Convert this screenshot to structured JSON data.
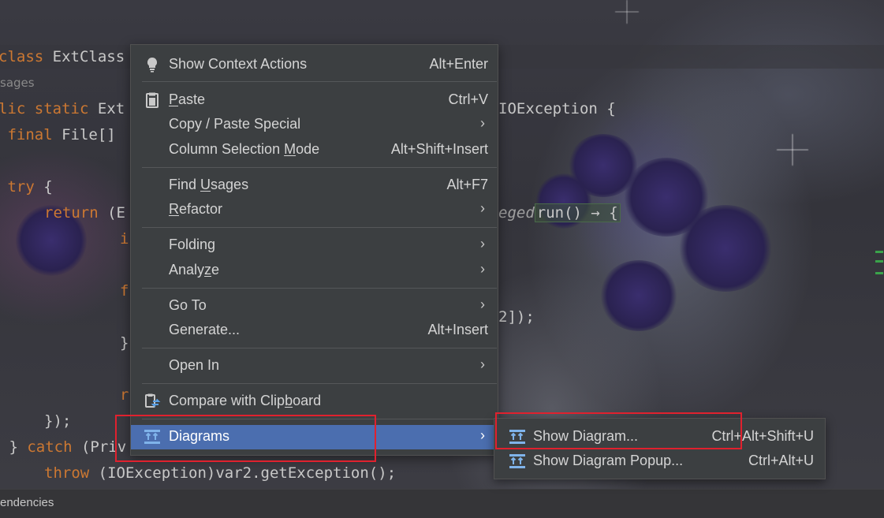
{
  "editor": {
    "lines": [
      {
        "kw": "",
        "text": "class ExtClass"
      },
      {
        "usages": "sages"
      },
      {
        "kw": "lic static ",
        "text": "Ext"
      },
      {
        "kw": " final ",
        "text": "File[]"
      },
      {
        "kw": " try",
        "text": " {"
      },
      {
        "kw": "return",
        "text": " (E"
      },
      {
        "text": "i"
      },
      {
        "text": "f"
      },
      {
        "text": "}"
      },
      {
        "text": "r"
      },
      {
        "text": "});"
      },
      {
        "kw": "catch",
        "pre": " } ",
        "text": " (Priv"
      },
      {
        "kw": "throw",
        "text": " (IOException)var2.getException();"
      }
    ],
    "right_fragments": {
      "ioexception": "IOException {",
      "privileged_fn": "eged",
      "lambda": "run() → {",
      "array_end": "2]);"
    }
  },
  "bottom_panel": {
    "label": "endencies"
  },
  "context_menu": {
    "items": [
      {
        "label": "Show Context Actions",
        "shortcut": "Alt+Enter",
        "icon": "bulb-icon"
      },
      {
        "label_pre": "",
        "label_u": "P",
        "label_post": "aste",
        "shortcut": "Ctrl+V",
        "icon": "clipboard-icon"
      },
      {
        "label": "Copy / Paste Special",
        "submenu": true
      },
      {
        "label_pre": "Column Selection ",
        "label_u": "M",
        "label_post": "ode",
        "shortcut": "Alt+Shift+Insert"
      },
      {
        "label_pre": "Find ",
        "label_u": "U",
        "label_post": "sages",
        "shortcut": "Alt+F7"
      },
      {
        "label_pre": "",
        "label_u": "R",
        "label_post": "efactor",
        "submenu": true
      },
      {
        "label": "Folding",
        "submenu": true
      },
      {
        "label_pre": "Analy",
        "label_u": "z",
        "label_post": "e",
        "submenu": true
      },
      {
        "label": "Go To",
        "submenu": true
      },
      {
        "label": "Generate...",
        "shortcut": "Alt+Insert"
      },
      {
        "label": "Open In",
        "submenu": true
      },
      {
        "label_pre": "Compare with Clip",
        "label_u": "b",
        "label_post": "oard",
        "icon": "compare-clipboard-icon"
      },
      {
        "label": "Diagrams",
        "submenu": true,
        "selected": true,
        "icon": "diagram-icon"
      }
    ],
    "arrow": "›"
  },
  "diagrams_submenu": {
    "items": [
      {
        "label": "Show Diagram...",
        "shortcut": "Ctrl+Alt+Shift+U",
        "icon": "diagram-icon"
      },
      {
        "label": "Show Diagram Popup...",
        "shortcut": "Ctrl+Alt+U",
        "icon": "diagram-icon"
      }
    ]
  },
  "colors": {
    "menu_bg": "#3c3f41",
    "selection": "#4b6eaf",
    "annotation": "#e0212e",
    "keyword": "#cc7832"
  }
}
